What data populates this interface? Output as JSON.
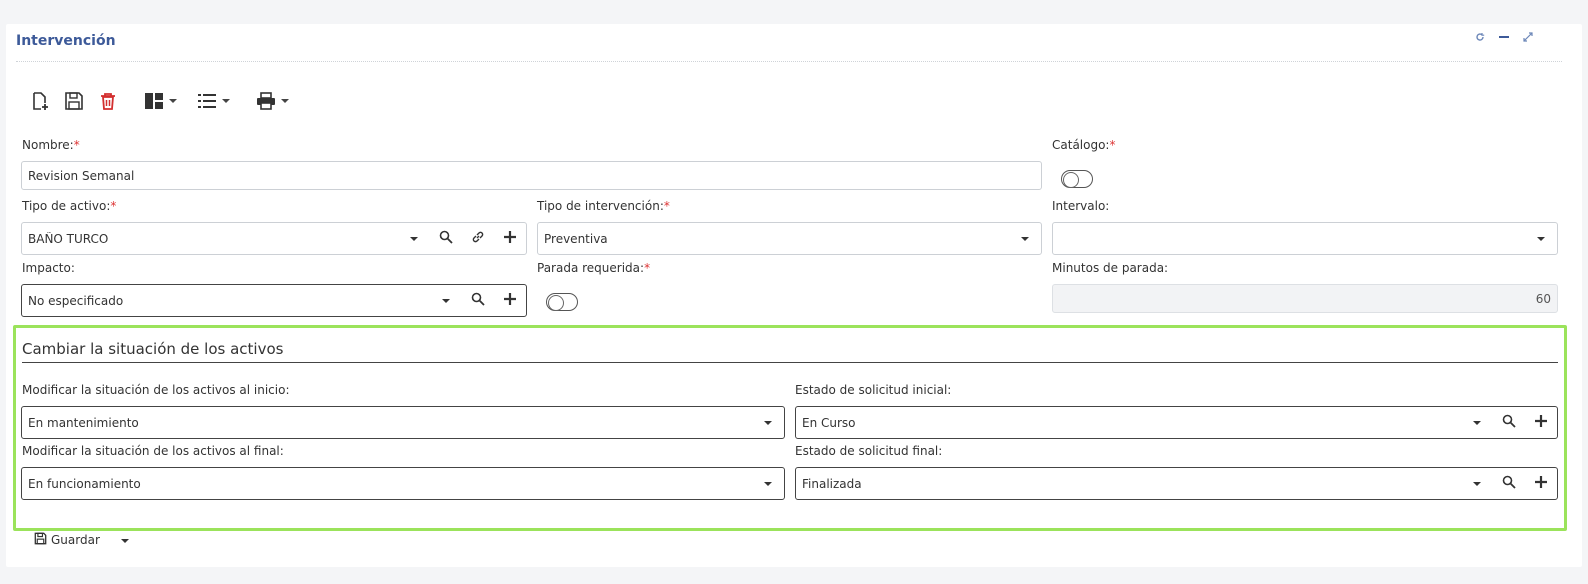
{
  "header": {
    "title": "Intervención"
  },
  "colors": {
    "accent": "#3d5a99",
    "highlight_border": "#9be35b",
    "required": "#dd3333",
    "delete": "#d32f2f"
  },
  "form": {
    "nombre": {
      "label": "Nombre:",
      "value": "Revision Semanal"
    },
    "catalogo": {
      "label": "Catálogo:"
    },
    "tipo_activo": {
      "label": "Tipo de activo:",
      "value": "BAÑO TURCO"
    },
    "tipo_intervencion": {
      "label": "Tipo de intervención:",
      "value": "Preventiva"
    },
    "intervalo": {
      "label": "Intervalo:",
      "value": ""
    },
    "impacto": {
      "label": "Impacto:",
      "value": "No especificado"
    },
    "parada": {
      "label": "Parada requerida:"
    },
    "minutos": {
      "label": "Minutos de parada:",
      "value": "60"
    },
    "required_mark": "*"
  },
  "section": {
    "title": "Cambiar la situación de los activos",
    "inicio": {
      "label": "Modificar la situación de los activos al inicio:",
      "value": "En mantenimiento"
    },
    "final": {
      "label": "Modificar la situación de los activos al final:",
      "value": "En funcionamiento"
    },
    "estado_inicial": {
      "label": "Estado de solicitud inicial:",
      "value": "En Curso"
    },
    "estado_final": {
      "label": "Estado de solicitud final:",
      "value": "Finalizada"
    }
  },
  "footer": {
    "save_label": "Guardar"
  }
}
